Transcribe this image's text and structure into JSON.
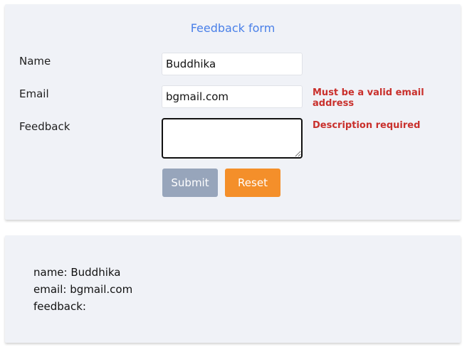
{
  "form": {
    "title": "Feedback form",
    "name_label": "Name",
    "email_label": "Email",
    "feedback_label": "Feedback",
    "name_value": "Buddhika",
    "email_value": "bgmail.com",
    "feedback_value": "",
    "email_error": "Must be a valid email address",
    "feedback_error": "Description required",
    "submit_label": "Submit",
    "reset_label": "Reset"
  },
  "output": {
    "name_line": "name: Buddhika",
    "email_line": "email: bgmail.com",
    "feedback_line": "feedback:"
  },
  "colors": {
    "title": "#4a80e8",
    "error": "#c9302c",
    "submit_disabled": "#97a5bb",
    "reset": "#f48f2a",
    "card_bg": "#f0f2f7"
  }
}
